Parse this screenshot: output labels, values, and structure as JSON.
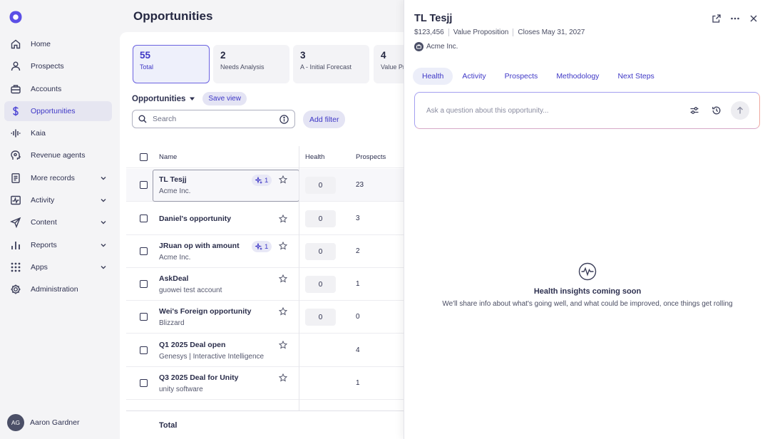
{
  "sidebar": {
    "items": [
      {
        "label": "Home",
        "icon": "home-icon"
      },
      {
        "label": "Prospects",
        "icon": "person-icon"
      },
      {
        "label": "Accounts",
        "icon": "building-icon"
      },
      {
        "label": "Opportunities",
        "icon": "dollar-icon",
        "active": true
      },
      {
        "label": "Kaia",
        "icon": "waveform-icon"
      },
      {
        "label": "Revenue agents",
        "icon": "agent-icon"
      },
      {
        "label": "More records",
        "icon": "records-icon",
        "expandable": true
      },
      {
        "label": "Activity",
        "icon": "activity-icon",
        "expandable": true
      },
      {
        "label": "Content",
        "icon": "send-icon",
        "expandable": true
      },
      {
        "label": "Reports",
        "icon": "bar-chart-icon",
        "expandable": true
      },
      {
        "label": "Apps",
        "icon": "grid-icon",
        "expandable": true
      },
      {
        "label": "Administration",
        "icon": "gear-icon"
      }
    ],
    "user": {
      "initials": "AG",
      "name": "Aaron Gardner"
    }
  },
  "main": {
    "title": "Opportunities",
    "stats": [
      {
        "count": "55",
        "label": "Total",
        "selected": true
      },
      {
        "count": "2",
        "label": "Needs Analysis"
      },
      {
        "count": "3",
        "label": "A - Initial Forecast"
      },
      {
        "count": "4",
        "label": "Value Pr"
      }
    ],
    "view_name": "Opportunities",
    "save_view": "Save view",
    "search_placeholder": "Search",
    "add_filter": "Add filter",
    "columns": {
      "name": "Name",
      "health": "Health",
      "prospects": "Prospects"
    },
    "rows": [
      {
        "name": "TL Tesjj",
        "account": "Acme Inc.",
        "ai_count": "1",
        "health": "0",
        "prospects": "23",
        "selected": true
      },
      {
        "name": "Daniel's opportunity",
        "account": "",
        "health": "0",
        "prospects": "3"
      },
      {
        "name": "JRuan op with amount",
        "account": "Acme Inc.",
        "ai_count": "1",
        "health": "0",
        "prospects": "2"
      },
      {
        "name": "AskDeal",
        "account": "guowei test account",
        "health": "0",
        "prospects": "1"
      },
      {
        "name": "Wei's Foreign opportunity",
        "account": "Blizzard",
        "health": "0",
        "prospects": "0"
      },
      {
        "name": "Q1 2025 Deal open",
        "account": "Genesys | Interactive Intelligence",
        "health": "",
        "prospects": "4"
      },
      {
        "name": "Q3 2025 Deal for Unity",
        "account": "unity software",
        "health": "",
        "prospects": "1"
      }
    ],
    "total_label": "Total"
  },
  "drawer": {
    "title": "TL Tesjj",
    "amount": "$123,456",
    "stage": "Value Proposition",
    "close_date": "Closes May 31, 2027",
    "account": "Acme Inc.",
    "tabs": [
      "Health",
      "Activity",
      "Prospects",
      "Methodology",
      "Next Steps"
    ],
    "active_tab": "Health",
    "ask_placeholder": "Ask a question about this opportunity...",
    "empty_title": "Health insights coming soon",
    "empty_text": "We'll share info about what's going well, and what could be improved, once things get rolling"
  }
}
